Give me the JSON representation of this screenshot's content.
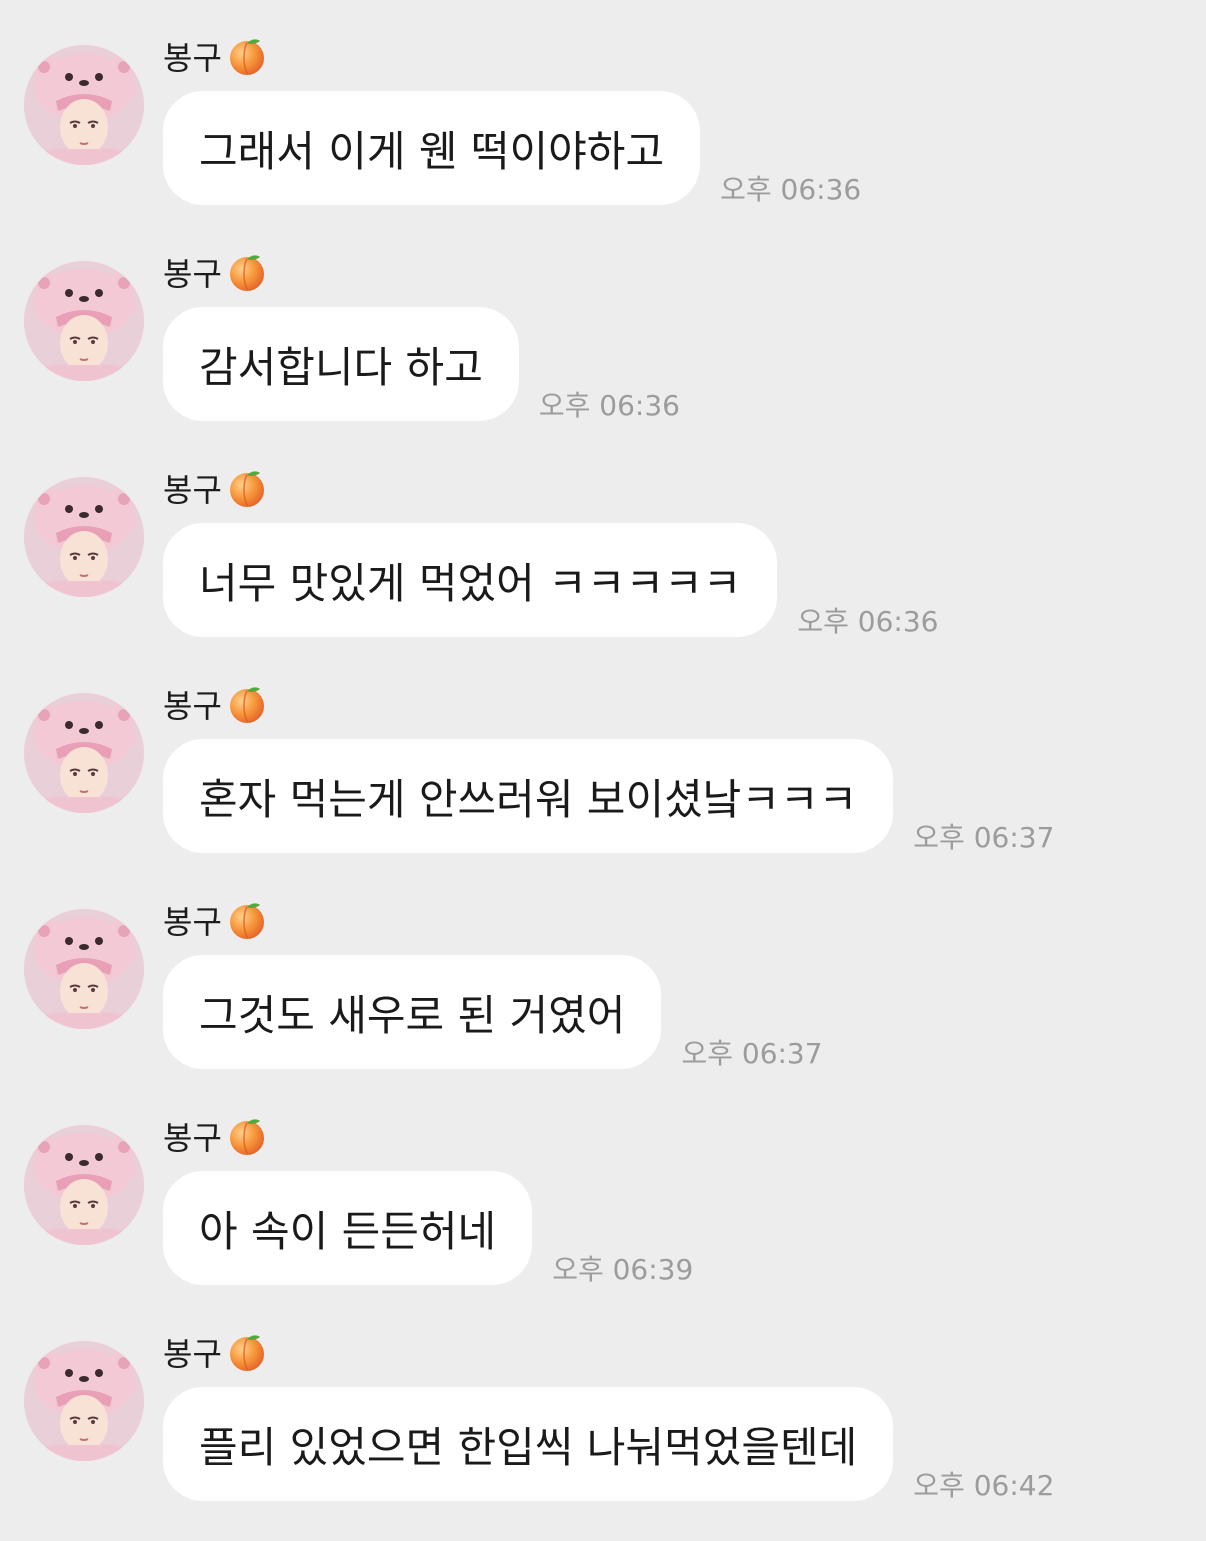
{
  "sender": {
    "name": "봉구",
    "emoji_icon": "peach-icon",
    "avatar": "avatar-pink-bear-hat"
  },
  "colors": {
    "background": "#ededed",
    "bubble": "#ffffff",
    "timestamp": "#9c9c9c",
    "text": "#1a1a1a"
  },
  "messages": [
    {
      "text": "그래서 이게 웬 떡이야하고",
      "time": "오후 06:36"
    },
    {
      "text": "감서합니다 하고",
      "time": "오후 06:36"
    },
    {
      "text": "너무 맛있게 먹었어 ㅋㅋㅋㅋㅋ",
      "time": "오후 06:36"
    },
    {
      "text": "혼자 먹는게 안쓰러워 보이셨낰ㅋㅋㅋ",
      "time": "오후 06:37"
    },
    {
      "text": "그것도 새우로 된 거였어",
      "time": "오후 06:37"
    },
    {
      "text": "아 속이 든든허네",
      "time": "오후 06:39"
    },
    {
      "text": "플리 있었으면 한입씩 나눠먹었을텐데",
      "time": "오후 06:42"
    }
  ]
}
